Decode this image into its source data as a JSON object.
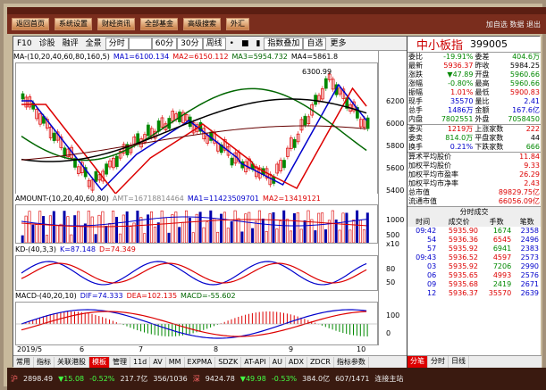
{
  "toolbar": {
    "buttons": [
      "返回首页",
      "系统设置",
      "财经资讯",
      "全部基金",
      "高级搜索",
      "外汇"
    ],
    "right": "加自选 数据 退出"
  },
  "chartbar": {
    "items": [
      "F10",
      "诊股",
      "融评",
      "全景",
      "分时",
      "日线",
      "60分",
      "30分",
      "周线",
      "•",
      "■",
      "▮",
      "指数叠加",
      "自选",
      "更多"
    ],
    "active": "日线"
  },
  "ma": {
    "label": "MA",
    "params": "(10,20,40,60,80,160,5)",
    "items": [
      {
        "t": "MA1=6100.134",
        "c": "#00c"
      },
      {
        "t": "MA2=6150.112",
        "c": "#d00"
      },
      {
        "t": "MA3=5954.732",
        "c": "#060"
      },
      {
        "t": "MA4=5861.8",
        "c": "#000"
      }
    ]
  },
  "amount": {
    "label": "AMOUNT",
    "params": "(10,20,40,60,80)",
    "items": [
      {
        "t": "AMT=16718814464",
        "c": "#888"
      },
      {
        "t": "MA1=11423509701",
        "c": "#00c"
      },
      {
        "t": "MA2=13419121",
        "c": "#d00"
      }
    ]
  },
  "kd": {
    "label": "KD",
    "params": "(40,3,3)",
    "items": [
      {
        "t": "K=87.148",
        "c": "#00c"
      },
      {
        "t": "D=74.349",
        "c": "#d00"
      }
    ]
  },
  "macd": {
    "label": "MACD",
    "params": "(40,20,10)",
    "items": [
      {
        "t": "DIF=74.333",
        "c": "#00c"
      },
      {
        "t": "DEA=102.135",
        "c": "#d00"
      },
      {
        "t": "MACD=-55.602",
        "c": "#060"
      }
    ]
  },
  "yaxis": {
    "price": [
      "6200",
      "6000",
      "5800",
      "5600",
      "5400"
    ],
    "amount": [
      "1000",
      "500"
    ],
    "kd": [
      "80",
      "50"
    ],
    "macd": [
      "100",
      "0"
    ],
    "amtunit": "x10"
  },
  "xaxis": [
    "2019/5",
    "6",
    "7",
    "8",
    "9",
    "10"
  ],
  "price_marks": {
    "high": "6300.99",
    "low": "5246.38"
  },
  "bottom_tabs": [
    "常用",
    "指标",
    "关联港股",
    "模板",
    "管理",
    "11d",
    "AV",
    "MM",
    "EXPMA",
    "SDZK",
    "AT-API",
    "AU",
    "ADX",
    "ZDCR",
    "指标参数"
  ],
  "bottom_active": "模板",
  "quote": {
    "name": "中小板指",
    "code": "399005",
    "weibi": "-19.91%",
    "weicha": "404.6万",
    "rows": [
      [
        "最新",
        "5936.37",
        "昨收",
        "5984.25",
        "red"
      ],
      [
        "涨跌",
        "▼47.89",
        "开盘",
        "5960.66",
        "grn"
      ],
      [
        "涨幅",
        "-0.80%",
        "最高",
        "5960.66",
        "grn"
      ],
      [
        "振幅",
        "1.01%",
        "最低",
        "5900.83",
        "red"
      ],
      [
        "现手",
        "35570",
        "量比",
        "2.41",
        "blu"
      ],
      [
        "总手",
        "1486万",
        "金额",
        "167.6亿",
        "blu"
      ],
      [
        "内盘",
        "7802551",
        "外盘",
        "7058450",
        "grn"
      ]
    ],
    "rows2": [
      [
        "委买",
        "1219万",
        "上涨家数",
        "222"
      ],
      [
        "委卖",
        "814.0万",
        "平盘家数",
        "44"
      ],
      [
        "换手",
        "0.21%",
        "下跌家数",
        "666"
      ]
    ],
    "rows3": [
      [
        "算术平均股价",
        "11.84"
      ],
      [
        "加权平均股价",
        "9.33"
      ],
      [
        "加权平均市盈率",
        "26.29"
      ],
      [
        "加权平均市净率",
        "2.43"
      ],
      [
        "总市值",
        "89829.75亿"
      ],
      [
        "流通市值",
        "66056.09亿"
      ]
    ]
  },
  "trades": {
    "title": "分时成交",
    "head": [
      "时间",
      "成交价",
      "手数",
      "笔数"
    ],
    "rows": [
      [
        "09:42",
        "5935.90",
        "1674",
        "2358"
      ],
      [
        "54",
        "5936.36",
        "6545",
        "2496"
      ],
      [
        "57",
        "5935.92",
        "6941",
        "2383"
      ],
      [
        "09:43",
        "5936.52",
        "4597",
        "2573"
      ],
      [
        "03",
        "5935.92",
        "7206",
        "2990"
      ],
      [
        "06",
        "5935.65",
        "4993",
        "2576"
      ],
      [
        "09",
        "5935.68",
        "2419",
        "2671"
      ],
      [
        "12",
        "5936.37",
        "35570",
        "2639"
      ]
    ]
  },
  "rtabs": [
    "分笔",
    "分时",
    "日线"
  ],
  "status": [
    "沪",
    "2898.49",
    "▼15.08",
    "-0.52%",
    "217.7亿",
    "356/1036",
    "深",
    "9424.78",
    "▼49.98",
    "-0.53%",
    "384.0亿",
    "607/1471",
    "连接主站"
  ]
}
